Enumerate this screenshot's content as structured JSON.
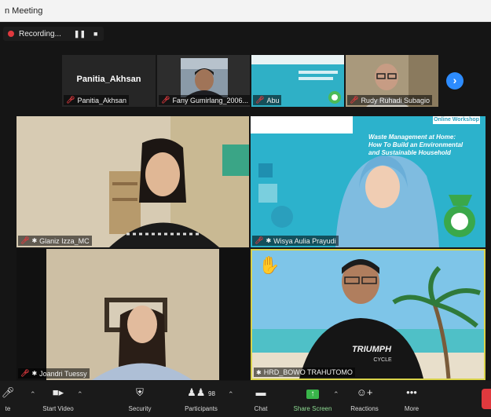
{
  "window": {
    "title": "n Meeting"
  },
  "recording": {
    "label": "Recording...",
    "pause": "❚❚",
    "stop": "■"
  },
  "strip": {
    "tiles": [
      {
        "name": "Panitia_Akhsan",
        "center_text": "Panitia_Akhsan"
      },
      {
        "name": "Fany Gumirlang_2006..."
      },
      {
        "name": "Abu"
      },
      {
        "name": "Rudy Ruhadi Subagio"
      }
    ],
    "next_icon": "chevron-right-icon"
  },
  "gallery": [
    {
      "name": "Glaniz Izza_MC"
    },
    {
      "name": "Wisya Aulia Prayudi",
      "slide": {
        "tag": "Online Workshop",
        "l1": "Waste Management at Home:",
        "l2": "How To Build an Environmental",
        "l3": "and Sustainable Household"
      }
    },
    {
      "name": "Joandri Tuessy"
    },
    {
      "name": "HRD_BOWO TRAHUTOMO",
      "shirt": "TRIUMPH",
      "shirt2": "CYCLE"
    }
  ],
  "toolbar": {
    "items": [
      {
        "label": "te"
      },
      {
        "label": "Start Video"
      },
      {
        "label": "Security"
      },
      {
        "label": "Participants",
        "count": "98"
      },
      {
        "label": "Chat"
      },
      {
        "label": "Share Screen"
      },
      {
        "label": "Reactions"
      },
      {
        "label": "More"
      }
    ]
  },
  "colors": {
    "active_speaker": "#d9d34a",
    "share_green": "#39b54a",
    "recording": "#e0393e",
    "next_button": "#2d8cff"
  }
}
